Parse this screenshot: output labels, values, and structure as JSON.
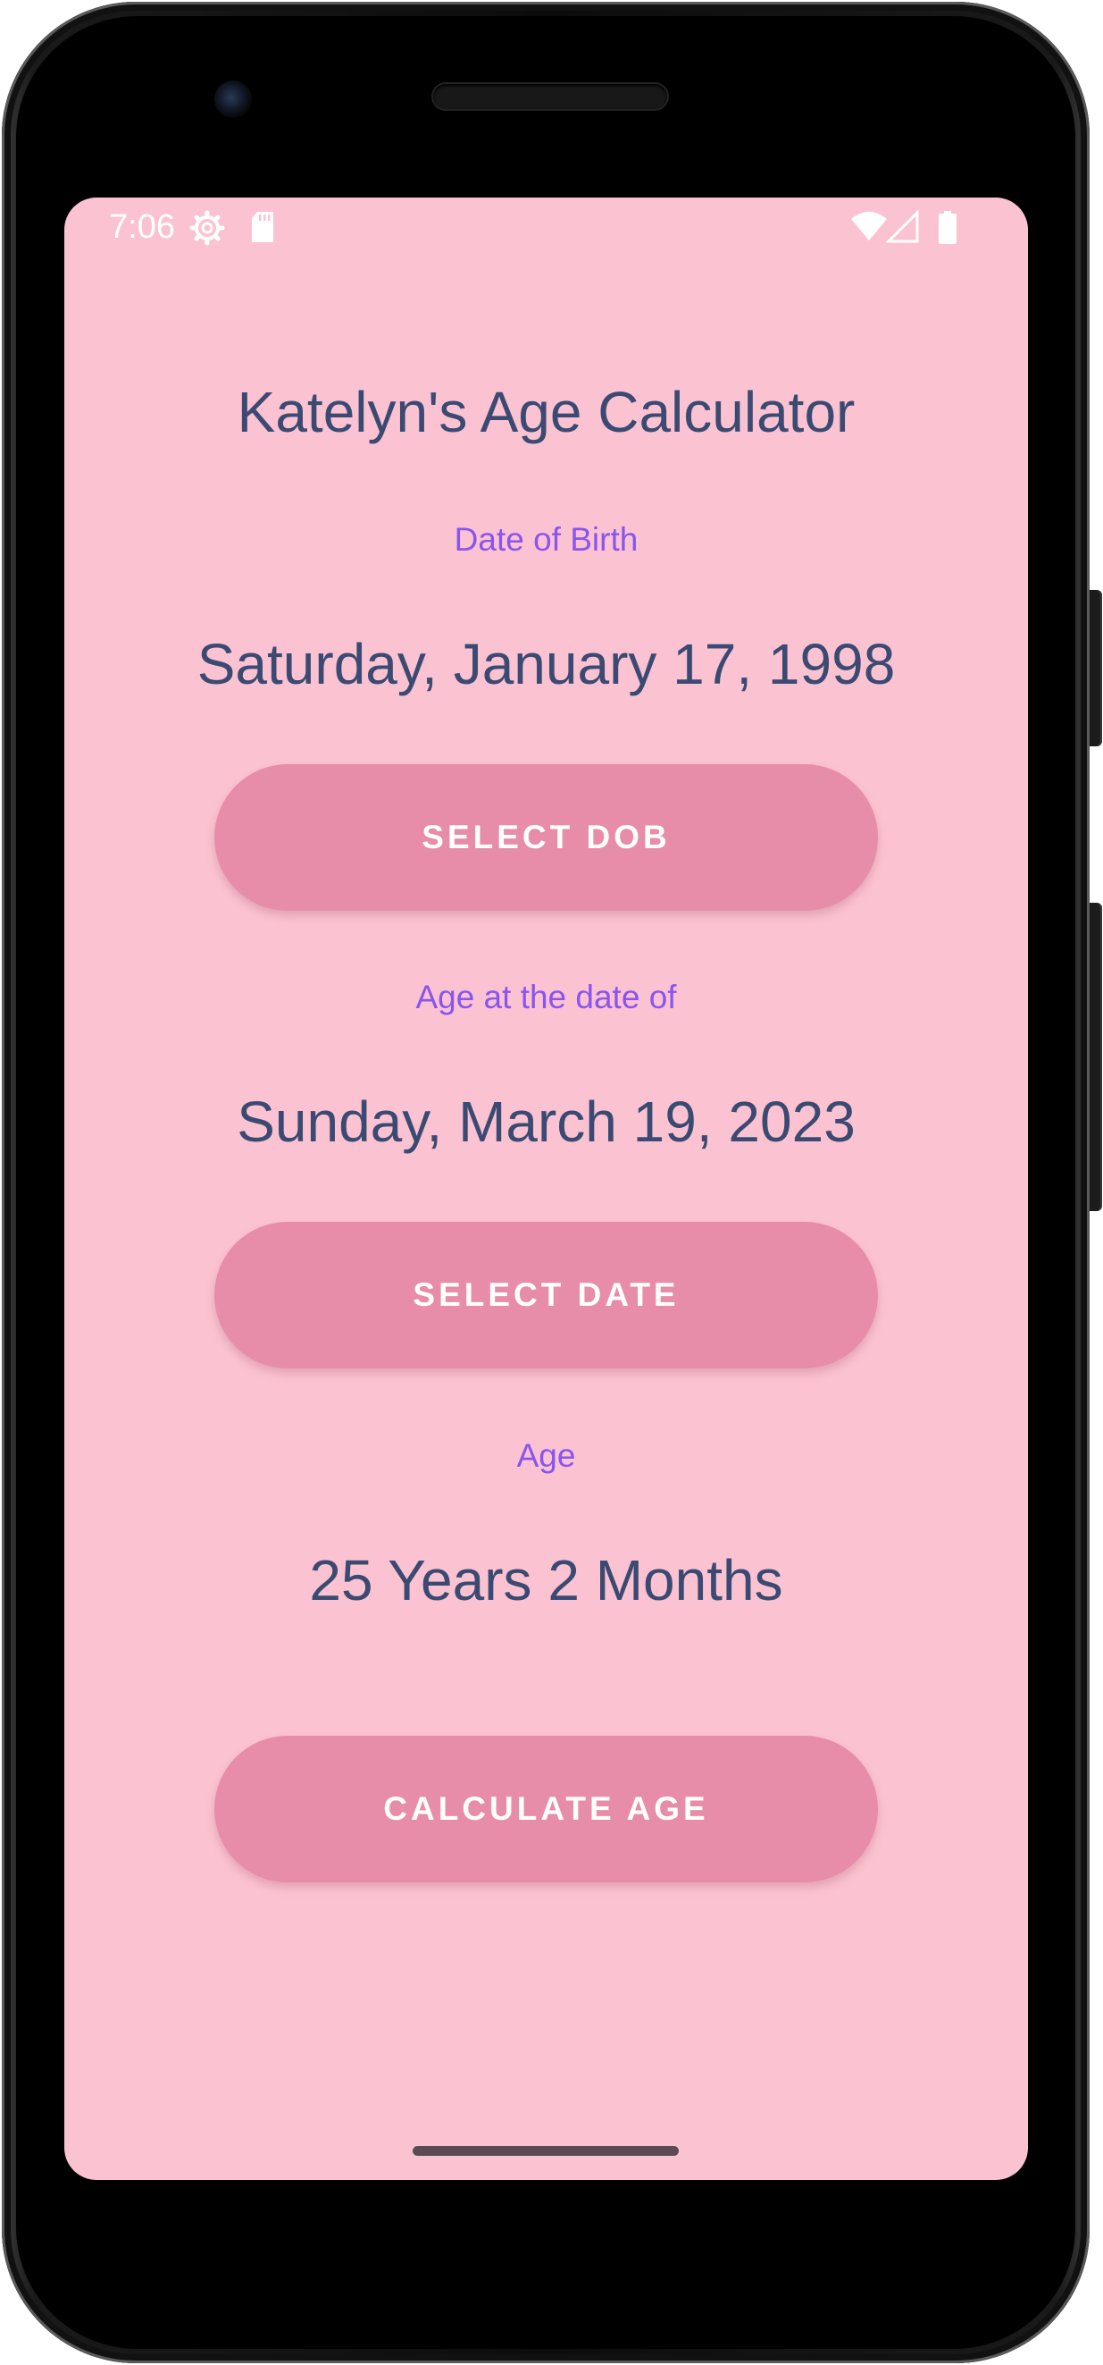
{
  "status_bar": {
    "time": "7:06",
    "icons": [
      "settings-icon",
      "sd-card-icon",
      "wifi-icon",
      "signal-icon",
      "battery-icon"
    ]
  },
  "app": {
    "title": "Katelyn's Age Calculator",
    "dob_label": "Date of Birth",
    "dob_value": "Saturday, January 17, 1998",
    "select_dob_button": "SELECT DOB",
    "age_at_label": "Age at the date of",
    "age_at_value": "Sunday, March 19, 2023",
    "select_date_button": "SELECT DATE",
    "age_label": "Age",
    "age_value": "25 Years 2 Months",
    "calculate_button": "CALCULATE AGE"
  },
  "colors": {
    "background": "#fbc3d1",
    "button": "#e78ca9",
    "primary_text": "#3b4a72",
    "accent_text": "#8a54f0"
  }
}
